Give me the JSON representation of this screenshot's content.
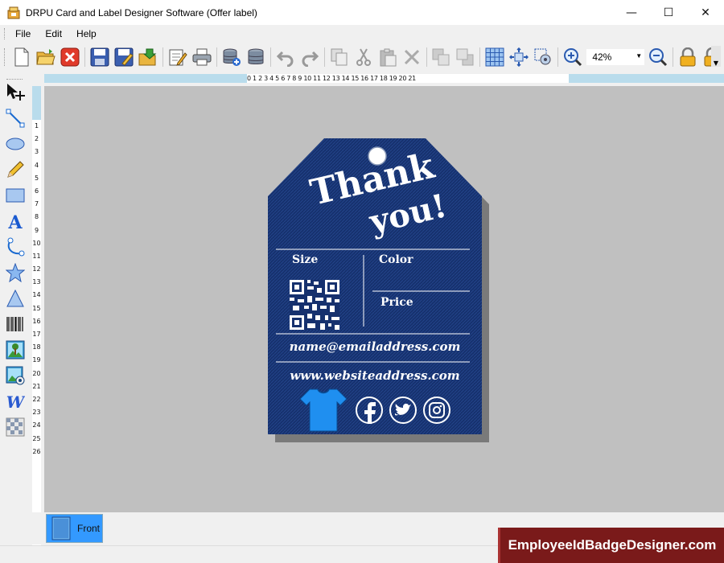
{
  "window": {
    "title": "DRPU Card and Label Designer Software (Offer label)",
    "controls": {
      "minimize": "—",
      "maximize": "☐",
      "close": "✕"
    }
  },
  "menu": {
    "file": "File",
    "edit": "Edit",
    "help": "Help"
  },
  "toolbar": {
    "zoom_value": "42%",
    "icons": [
      "new-icon",
      "open-icon",
      "close-doc-icon",
      "save-icon",
      "save-as-icon",
      "export-icon",
      "edit-icon",
      "print-icon",
      "database-add-icon",
      "database-icon",
      "undo-icon",
      "redo-icon",
      "copy-icon",
      "cut-icon",
      "paste-icon",
      "delete-icon",
      "bring-front-icon",
      "send-back-icon",
      "grid-icon",
      "fit-icon",
      "center-icon",
      "zoom-in-icon",
      "zoom-out-icon",
      "lock-icon",
      "unlock-icon"
    ]
  },
  "tools": [
    "select-icon",
    "line-icon",
    "ellipse-icon",
    "pencil-icon",
    "rectangle-icon",
    "text-icon",
    "arc-icon",
    "star-icon",
    "triangle-icon",
    "barcode-icon",
    "image-icon",
    "picture-library-icon",
    "word-art-icon",
    "watermark-icon"
  ],
  "ruler": {
    "top": "0 1 2 3 4 5 6 7 8 9 10 11 12 13 14 15 16 17 18 19 20 21",
    "left": [
      "1",
      "2",
      "3",
      "4",
      "5",
      "6",
      "7",
      "8",
      "9",
      "10",
      "11",
      "12",
      "13",
      "14",
      "15",
      "16",
      "17",
      "18",
      "19",
      "20",
      "21",
      "22",
      "23",
      "24",
      "25",
      "26"
    ]
  },
  "label": {
    "thank": "Thank",
    "you": "you!",
    "size": "Size",
    "color": "Color",
    "price": "Price",
    "email": "name@emailaddress.com",
    "website": "www.websiteaddress.com",
    "colors": {
      "tag": "#16316e",
      "tshirt": "#1f8ff0"
    }
  },
  "pages": {
    "front": "Front"
  },
  "brand": "EmployeeIdBadgeDesigner.com"
}
